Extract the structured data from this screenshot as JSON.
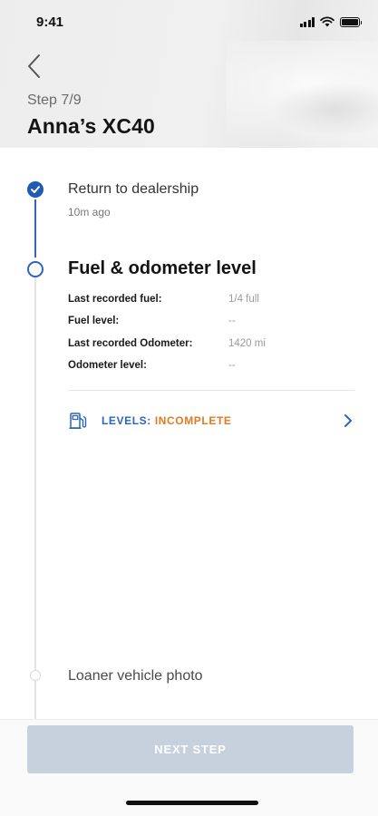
{
  "status_bar": {
    "time": "9:41",
    "icons": [
      "signal-icon",
      "wifi-icon",
      "battery-icon"
    ]
  },
  "header": {
    "back_icon": "chevron-left-icon",
    "step": "Step 7/9",
    "title": "Anna’s XC40"
  },
  "timeline": {
    "completed": {
      "title": "Return to dealership",
      "time": "10m ago",
      "icon": "check-icon"
    },
    "current": {
      "title": "Fuel & odometer level",
      "details": [
        {
          "label": "Last recorded fuel:",
          "value": "1/4 full"
        },
        {
          "label": "Fuel level:",
          "value": "--"
        },
        {
          "label": "Last recorded Odometer:",
          "value": "1420 mi"
        },
        {
          "label": "Odometer level:",
          "value": "--"
        }
      ],
      "levels": {
        "icon": "fuel-pump-icon",
        "key": "LEVELS:",
        "status": "INCOMPLETE",
        "chevron_icon": "chevron-right-icon"
      }
    },
    "next": {
      "title": "Loaner vehicle photo"
    }
  },
  "footer": {
    "next_button": "NEXT STEP"
  },
  "colors": {
    "accent": "#2f65b8",
    "warning": "#e07b22",
    "button_disabled": "#c6d1dd"
  }
}
